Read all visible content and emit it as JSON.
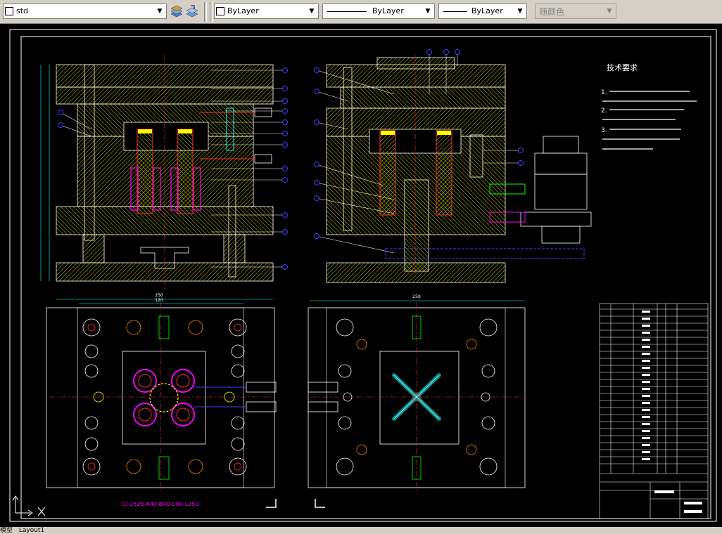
{
  "toolbar": {
    "textstyle_value": "std",
    "layer_value": "ByLayer",
    "linetype_value": "ByLayer",
    "lineweight_value": "ByLayer",
    "color_value": "随颜色"
  },
  "drawing": {
    "tech_title": "技术要求",
    "tech_notes": [
      "1.",
      "2.",
      "3."
    ],
    "mold_code": "CI-2525-A40-B40-C80-L250",
    "dim_top_a": "250",
    "dim_top_b": "120",
    "dim_right_a": "250"
  },
  "tabs": {
    "model": "模型",
    "layout1": "Layout1"
  },
  "colors": {
    "background": "#000000",
    "line_white": "#ffffff",
    "hatch_yellow": "#c8c800",
    "accent_red": "#ff3030",
    "accent_magenta": "#ff00ff",
    "accent_cyan": "#00ffff",
    "accent_blue": "#4040ff",
    "accent_green": "#00ff00"
  }
}
